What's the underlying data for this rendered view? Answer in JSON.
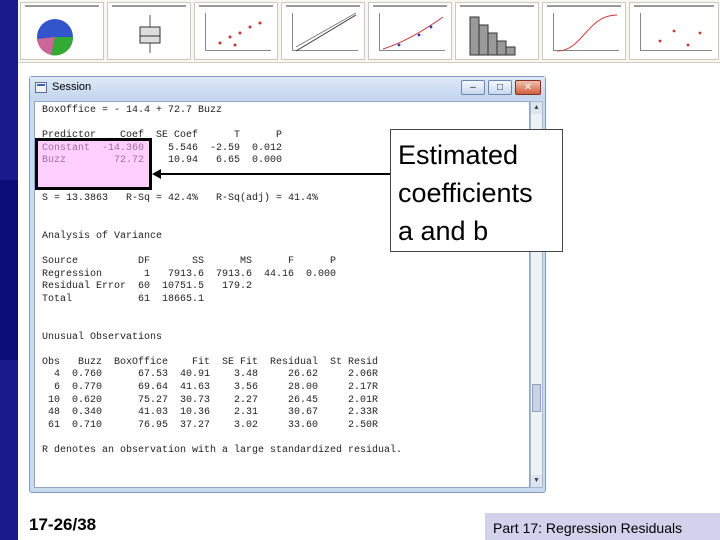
{
  "window": {
    "title": "Session",
    "minimize_icon": "minimize-icon",
    "maximize_icon": "maximize-icon",
    "close_icon": "close-icon"
  },
  "session_output": "BoxOffice = - 14.4 + 72.7 Buzz\n\nPredictor    Coef  SE Coef      T      P\nConstant  -14.360    5.546  -2.59  0.012\nBuzz        72.72    10.94   6.65  0.000\n\n\nS = 13.3863   R-Sq = 42.4%   R-Sq(adj) = 41.4%\n\n\nAnalysis of Variance\n\nSource          DF       SS      MS      F      P\nRegression       1   7913.6  7913.6  44.16  0.000\nResidual Error  60  10751.5   179.2\nTotal           61  18665.1\n\n\nUnusual Observations\n\nObs   Buzz  BoxOffice    Fit  SE Fit  Residual  St Resid\n  4  0.760      67.53  40.91    3.48     26.62     2.06R\n  6  0.770      69.64  41.63    3.56     28.00     2.17R\n 10  0.620      75.27  30.73    2.27     26.45     2.01R\n 48  0.340      41.03  10.36    2.31     30.67     2.33R\n 61  0.710      76.95  37.27    3.02     33.60     2.50R\n\nR denotes an observation with a large standardized residual.",
  "callout": "Estimated\ncoefficients\na and b",
  "slide_number": "17-26/38",
  "footer": "Part 17: Regression Residuals",
  "colors": {
    "left_bar": "#1a1a8c",
    "highlight": "#ffaaff",
    "footer_bg": "#d2d2ec",
    "window_frame": "#c9d9ee"
  }
}
